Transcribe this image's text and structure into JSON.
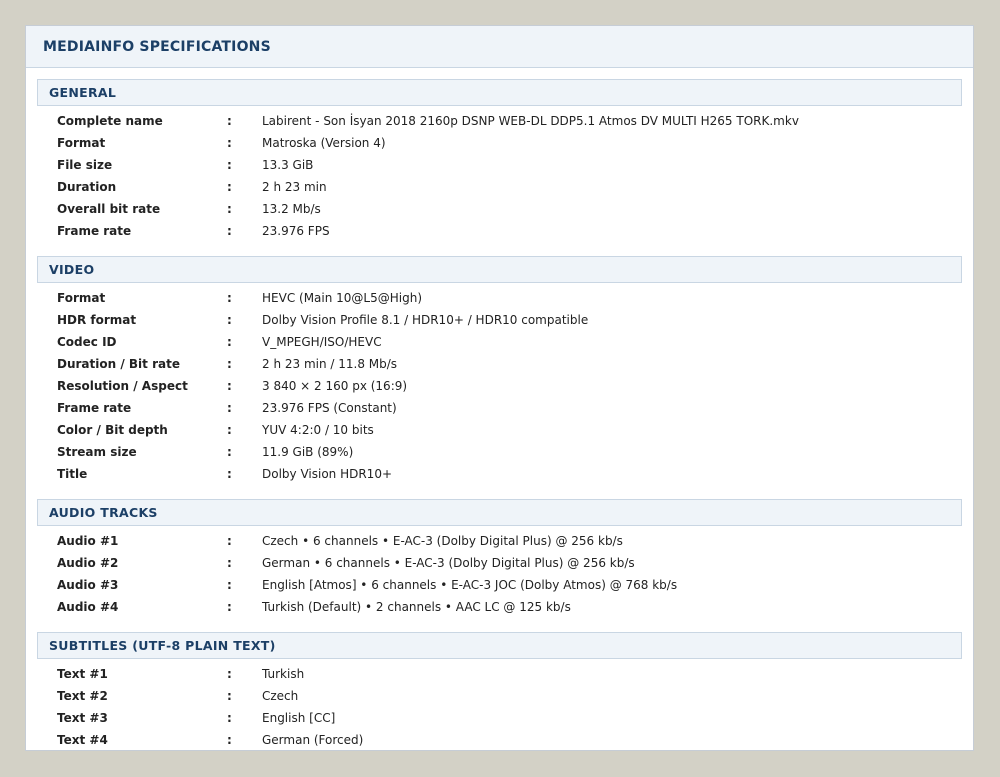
{
  "panel": {
    "title": "MEDIAINFO SPECIFICATIONS"
  },
  "separator": ":",
  "sections": [
    {
      "id": "general",
      "title": "GENERAL",
      "rows": [
        {
          "label": "Complete name",
          "value": "Labirent - Son İsyan 2018 2160p DSNP WEB-DL DDP5.1 Atmos DV MULTI H265 TORK.mkv"
        },
        {
          "label": "Format",
          "value": "Matroska (Version 4)"
        },
        {
          "label": "File size",
          "value": "13.3 GiB"
        },
        {
          "label": "Duration",
          "value": "2 h 23 min"
        },
        {
          "label": "Overall bit rate",
          "value": "13.2 Mb/s"
        },
        {
          "label": "Frame rate",
          "value": "23.976 FPS"
        }
      ]
    },
    {
      "id": "video",
      "title": "VIDEO",
      "rows": [
        {
          "label": "Format",
          "value": "HEVC (Main 10@L5@High)"
        },
        {
          "label": "HDR format",
          "value": "Dolby Vision Profile 8.1 / HDR10+ / HDR10 compatible"
        },
        {
          "label": "Codec ID",
          "value": "V_MPEGH/ISO/HEVC"
        },
        {
          "label": "Duration / Bit rate",
          "value": "2 h 23 min / 11.8 Mb/s"
        },
        {
          "label": "Resolution / Aspect",
          "value": "3 840 × 2 160 px (16:9)"
        },
        {
          "label": "Frame rate",
          "value": "23.976 FPS (Constant)"
        },
        {
          "label": "Color / Bit depth",
          "value": "YUV 4:2:0 / 10 bits"
        },
        {
          "label": "Stream size",
          "value": "11.9 GiB (89%)"
        },
        {
          "label": "Title",
          "value": "Dolby Vision HDR10+"
        }
      ]
    },
    {
      "id": "audio",
      "title": "AUDIO TRACKS",
      "rows": [
        {
          "label": "Audio #1",
          "value": "Czech • 6 channels • E-AC-3 (Dolby Digital Plus) @ 256 kb/s"
        },
        {
          "label": "Audio #2",
          "value": "German • 6 channels • E-AC-3 (Dolby Digital Plus) @ 256 kb/s"
        },
        {
          "label": "Audio #3",
          "value": "English [Atmos] • 6 channels • E-AC-3 JOC (Dolby Atmos) @ 768 kb/s"
        },
        {
          "label": "Audio #4",
          "value": "Turkish (Default) • 2 channels • AAC LC @ 125 kb/s"
        }
      ]
    },
    {
      "id": "subtitles",
      "title": "SUBTITLES (UTF-8 PLAIN TEXT)",
      "rows": [
        {
          "label": "Text #1",
          "value": "Turkish"
        },
        {
          "label": "Text #2",
          "value": "Czech"
        },
        {
          "label": "Text #3",
          "value": "English [CC]"
        },
        {
          "label": "Text #4",
          "value": "German (Forced)"
        }
      ]
    }
  ]
}
